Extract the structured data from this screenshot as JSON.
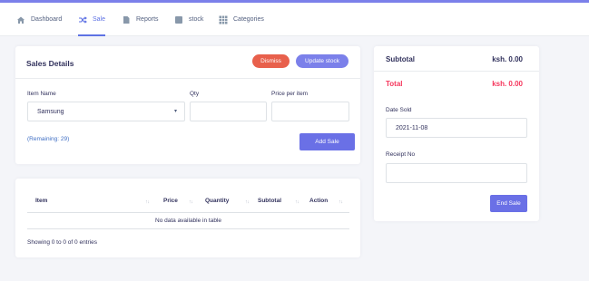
{
  "nav": {
    "items": [
      {
        "label": "Dashboard",
        "icon": "home-icon"
      },
      {
        "label": "Sale",
        "icon": "shuffle-icon"
      },
      {
        "label": "Reports",
        "icon": "document-icon"
      },
      {
        "label": "stock",
        "icon": "stock-icon"
      },
      {
        "label": "Categories",
        "icon": "grid-icon"
      }
    ],
    "active": "Sale"
  },
  "sales_details": {
    "title": "Sales Details",
    "dismiss_label": "Dismiss",
    "update_stock_label": "Update stock",
    "item_name_label": "Item Name",
    "item_name_value": "Samsung",
    "qty_label": "Qty",
    "qty_value": "",
    "price_label": "Price per item",
    "price_value": "",
    "remaining_text": "(Remaining: 29)",
    "add_sale_label": "Add Sale"
  },
  "table": {
    "columns": [
      "Item",
      "Price",
      "Quantity",
      "Subtotal",
      "Action"
    ],
    "empty_text": "No data available in table",
    "info_text": "Showing 0 to 0 of 0 entries"
  },
  "summary": {
    "subtotal_label": "Subtotal",
    "subtotal_value": "ksh. 0.00",
    "total_label": "Total",
    "total_value": "ksh. 0.00",
    "date_label": "Date Sold",
    "date_value": "2021-11-08",
    "receipt_label": "Receipt No",
    "receipt_value": "",
    "end_sale_label": "End Sale"
  },
  "colors": {
    "accent": "#5e72e4",
    "danger": "#f5365c",
    "dismiss": "#e8604c",
    "brand_bar": "#7b80ea"
  }
}
